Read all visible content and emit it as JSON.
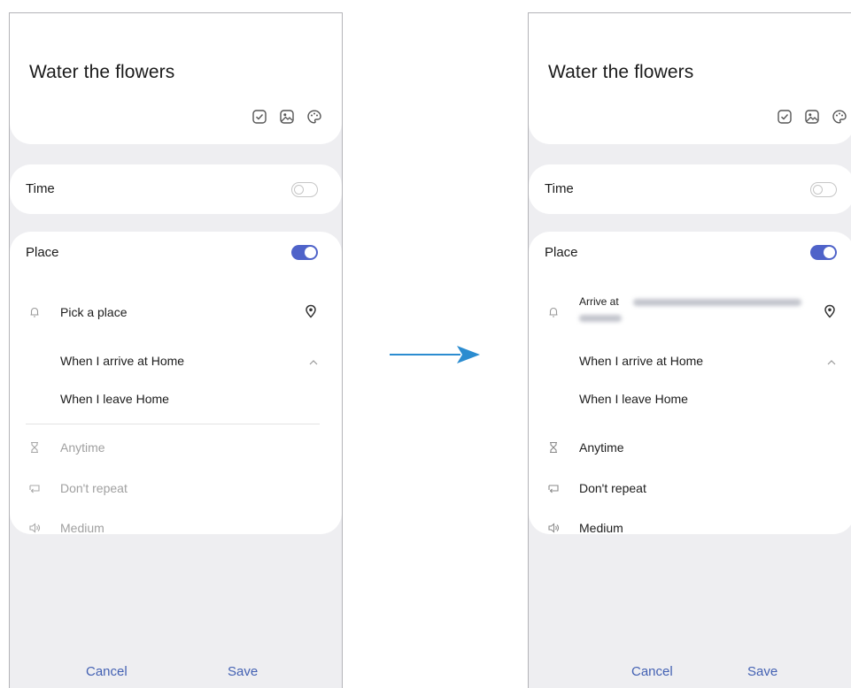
{
  "left": {
    "title": "Water the flowers",
    "time_label": "Time",
    "time_toggle": "off",
    "place_label": "Place",
    "place_toggle": "on",
    "pick_place": "Pick a place",
    "arrive_option": "When I arrive at Home",
    "leave_option": "When I leave Home",
    "anytime": "Anytime",
    "repeat": "Don't repeat",
    "priority": "Medium",
    "cancel": "Cancel",
    "save": "Save"
  },
  "right": {
    "title": "Water the flowers",
    "time_label": "Time",
    "time_toggle": "off",
    "place_label": "Place",
    "place_toggle": "on",
    "arrive_at": "Arrive at",
    "arrive_option": "When I arrive at Home",
    "leave_option": "When I leave Home",
    "anytime": "Anytime",
    "repeat": "Don't repeat",
    "priority": "Medium",
    "cancel": "Cancel",
    "save": "Save"
  },
  "colors": {
    "accent": "#4361b3",
    "toggle_on": "#4f63c9",
    "arrow": "#2b8cd0",
    "background": "#eeeef1"
  },
  "icons": [
    "checkbox-icon",
    "image-icon",
    "palette-icon",
    "bell-icon",
    "location-pin-icon",
    "chevron-up-icon",
    "hourglass-icon",
    "repeat-icon",
    "volume-icon",
    "arrow-right-icon"
  ]
}
